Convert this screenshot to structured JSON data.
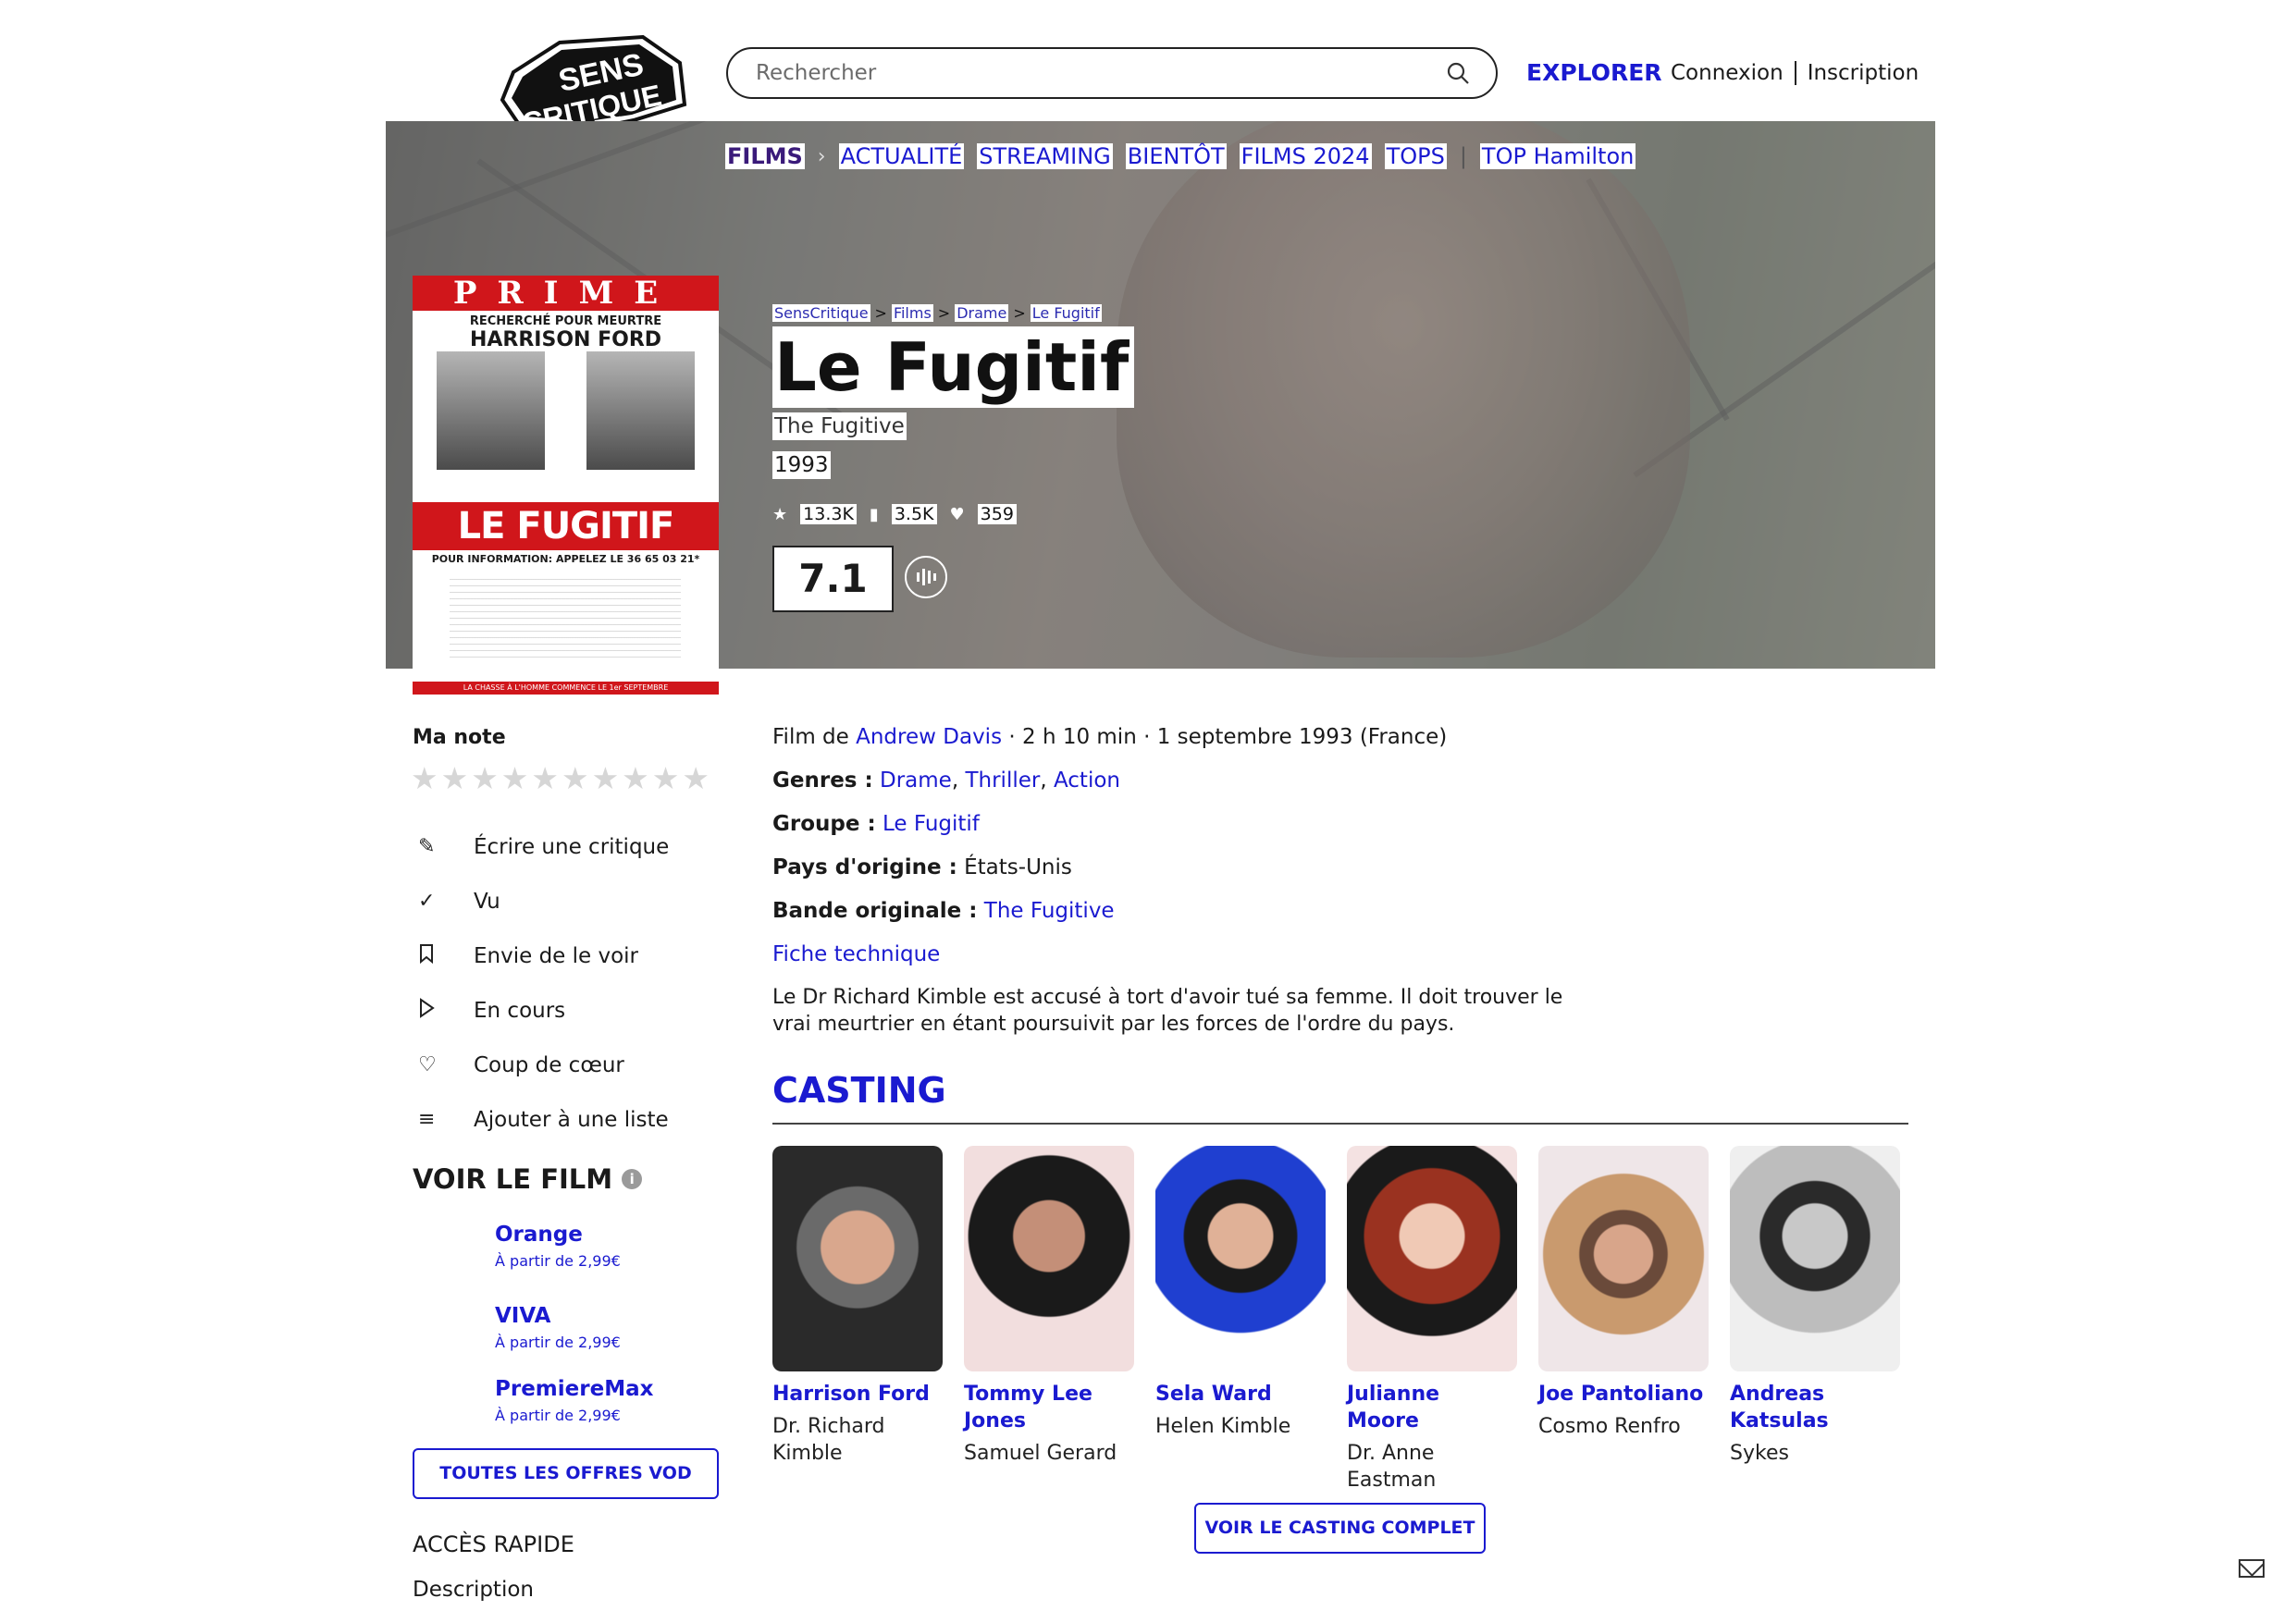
{
  "header": {
    "logo_text": [
      "SENS",
      "CRITIQUE"
    ],
    "search_placeholder": "Rechercher",
    "explorer": "EXPLORER",
    "login": "Connexion",
    "signup": "Inscription"
  },
  "subnav": {
    "items": [
      "FILMS",
      "ACTUALITÉ",
      "STREAMING",
      "BIENTÔT",
      "FILMS 2024",
      "TOPS",
      "TOP Hamilton"
    ]
  },
  "breadcrumb": [
    "SensCritique",
    "Films",
    "Drame",
    "Le Fugitif"
  ],
  "film": {
    "title": "Le Fugitif",
    "original_title": "The Fugitive",
    "year": "1993",
    "ratings_count": "13.3K",
    "wishlist_count": "3.5K",
    "favorites_count": "359",
    "score": "7.1"
  },
  "poster": {
    "band": "PRIME",
    "recherche": "RECHERCHÉ POUR MEURTRE",
    "actor": "HARRISON FORD",
    "title": "LE FUGITIF",
    "info": "POUR INFORMATION: APPELEZ LE 36 65 03 21*",
    "tagline": "LA CHASSE À L'HOMME COMMENCE LE 1er SEPTEMBRE"
  },
  "sidebar": {
    "my_rating": "Ma note",
    "actions": [
      {
        "icon": "pencil-icon",
        "label": "Écrire une critique"
      },
      {
        "icon": "check-icon",
        "label": "Vu"
      },
      {
        "icon": "bookmark-icon",
        "label": "Envie de le voir"
      },
      {
        "icon": "play-icon",
        "label": "En cours"
      },
      {
        "icon": "heart-icon",
        "label": "Coup de cœur"
      },
      {
        "icon": "add-list-icon",
        "label": "Ajouter à une liste"
      }
    ],
    "watch_title": "VOIR LE FILM",
    "offers": [
      {
        "name": "Orange",
        "price": "À partir de 2,99€"
      },
      {
        "name": "VIVA",
        "price": "À partir de 2,99€"
      },
      {
        "name": "PremiereMax",
        "price": "À partir de 2,99€"
      }
    ],
    "all_offers": "TOUTES LES OFFRES VOD",
    "quick_access": "ACCÈS RAPIDE",
    "description": "Description"
  },
  "details": {
    "film_de_prefix": "Film de",
    "director": "Andrew Davis",
    "meta_suffix": "· 2 h 10 min · 1 septembre 1993 (France)",
    "genres_label": "Genres :",
    "genres": [
      "Drame",
      "Thriller",
      "Action"
    ],
    "group_label": "Groupe :",
    "group": "Le Fugitif",
    "country_label": "Pays d'origine :",
    "country": "États-Unis",
    "soundtrack_label": "Bande originale :",
    "soundtrack": "The Fugitive",
    "tech_sheet": "Fiche technique",
    "synopsis": "Le Dr Richard Kimble est accusé à tort d'avoir tué sa femme. Il doit trouver le vrai meurtrier en étant poursuivit par les forces de l'ordre du pays."
  },
  "casting": {
    "title": "CASTING",
    "members": [
      {
        "name": "Harrison Ford",
        "role": "Dr. Richard Kimble"
      },
      {
        "name": "Tommy Lee Jones",
        "role": "Samuel Gerard"
      },
      {
        "name": "Sela Ward",
        "role": "Helen Kimble"
      },
      {
        "name": "Julianne Moore",
        "role": "Dr. Anne Eastman"
      },
      {
        "name": "Joe Pantoliano",
        "role": "Cosmo Renfro"
      },
      {
        "name": "Andreas Katsulas",
        "role": "Sykes"
      }
    ],
    "full_cast_button": "VOIR LE CASTING COMPLET"
  },
  "colors": {
    "accent": "#1a1ad0",
    "poster_red": "#d0161b"
  }
}
